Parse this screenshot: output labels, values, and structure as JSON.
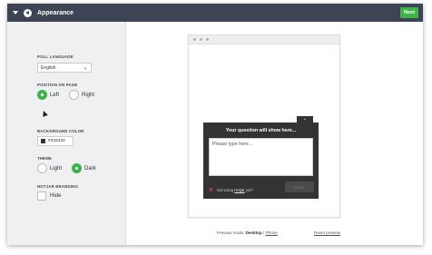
{
  "header": {
    "title": "Appearance",
    "next_label": "Next"
  },
  "sidebar": {
    "poll_language_label": "POLL LANGUAGE",
    "poll_language_value": "English",
    "position_label": "POSITION ON PAGE",
    "position_left": "Left",
    "position_right": "Right",
    "position_selected": "Left",
    "bg_color_label": "BACKGROUND COLOR",
    "bg_color_value": "#333333",
    "theme_label": "THEME",
    "theme_light": "Light",
    "theme_dark": "Dark",
    "theme_selected": "Dark",
    "branding_label": "HOTJAR BRANDING",
    "branding_hide": "Hide"
  },
  "poll": {
    "question": "Your question will show here...",
    "placeholder": "Please type here...",
    "footer_prefix": "Not using",
    "footer_link": "Hotjar",
    "footer_suffix": "yet?",
    "send_label": "Send"
  },
  "preview": {
    "mode_label": "Preview mode:",
    "desktop": "Desktop",
    "separator": "|",
    "phone": "Phone",
    "reset": "Reset preview"
  },
  "colors": {
    "header_bg": "#3d4454",
    "accent_green": "#3db34a",
    "poll_bg": "#333333"
  }
}
